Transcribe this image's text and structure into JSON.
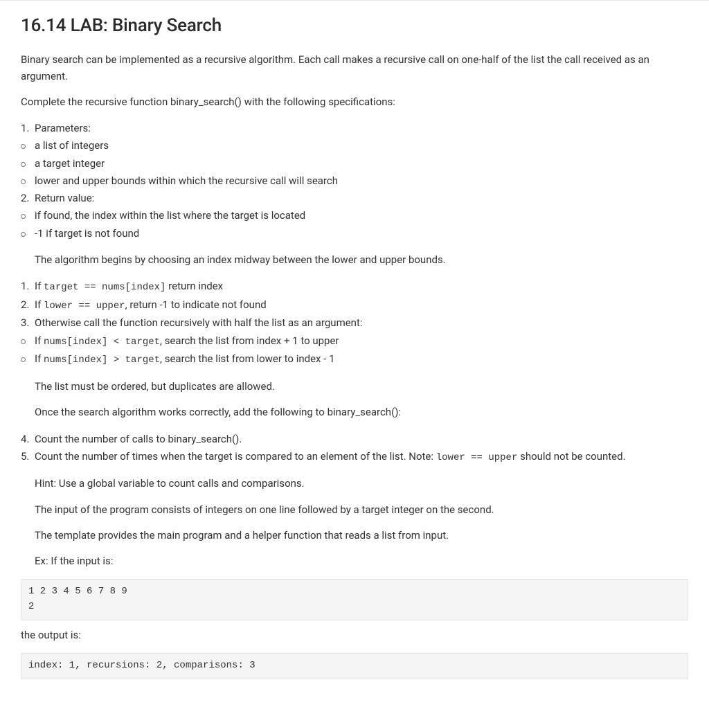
{
  "title": "16.14 LAB: Binary Search",
  "intro_p1": "Binary search can be implemented as a recursive algorithm. Each call makes a recursive call on one-half of the list the call received as an argument.",
  "intro_p2": "Complete the recursive function binary_search() with the following specifications:",
  "spec_list": [
    {
      "type": "num",
      "marker": "1.",
      "text": "Parameters:"
    },
    {
      "type": "bul",
      "text": "a list of integers"
    },
    {
      "type": "bul",
      "text": "a target integer"
    },
    {
      "type": "bul",
      "text": "lower and upper bounds within which the recursive call will search"
    },
    {
      "type": "num",
      "marker": "2.",
      "text": "Return value:"
    },
    {
      "type": "bul",
      "text": "if found, the index within the list where the target is located"
    },
    {
      "type": "bul",
      "text": "-1 if target is not found"
    }
  ],
  "algo_p1": "The algorithm begins by choosing an index midway between the lower and upper bounds.",
  "algo_list": [
    {
      "type": "num",
      "marker": "1.",
      "segments": [
        {
          "t": "If "
        },
        {
          "t": "target == nums[index]",
          "mono": true
        },
        {
          "t": " return index"
        }
      ]
    },
    {
      "type": "num",
      "marker": "2.",
      "segments": [
        {
          "t": "If "
        },
        {
          "t": "lower == upper",
          "mono": true
        },
        {
          "t": ", return -1 to indicate not found"
        }
      ]
    },
    {
      "type": "num",
      "marker": "3.",
      "segments": [
        {
          "t": "Otherwise call the function recursively with half the list as an argument:"
        }
      ]
    },
    {
      "type": "bul",
      "segments": [
        {
          "t": "If "
        },
        {
          "t": "nums[index] < target",
          "mono": true
        },
        {
          "t": ", search the list from index + 1 to upper"
        }
      ]
    },
    {
      "type": "bul",
      "segments": [
        {
          "t": "If "
        },
        {
          "t": "nums[index] > target",
          "mono": true
        },
        {
          "t": ", search the list from lower to index - 1"
        }
      ]
    }
  ],
  "algo_p2": "The list must be ordered, but duplicates are allowed.",
  "once_p": "Once the search algorithm works correctly, add the following to binary_search():",
  "count_list": [
    {
      "type": "num",
      "marker": "4.",
      "segments": [
        {
          "t": "Count the number of calls to binary_search()."
        }
      ]
    },
    {
      "type": "num",
      "marker": "5.",
      "segments": [
        {
          "t": "Count the number of times when the target is compared to an element of the list. Note: "
        },
        {
          "t": "lower == upper",
          "mono": true
        },
        {
          "t": " should not be counted."
        }
      ]
    }
  ],
  "hint_p": "Hint: Use a global variable to count calls and comparisons.",
  "input_p": "The input of the program consists of integers on one line followed by a target integer on the second.",
  "template_p": "The template provides the main program and a helper function that reads a list from input.",
  "ex_label": "Ex: If the input is:",
  "example_input": "1 2 3 4 5 6 7 8 9\n2",
  "output_label": "the output is:",
  "example_output": "index: 1, recursions: 2, comparisons: 3"
}
